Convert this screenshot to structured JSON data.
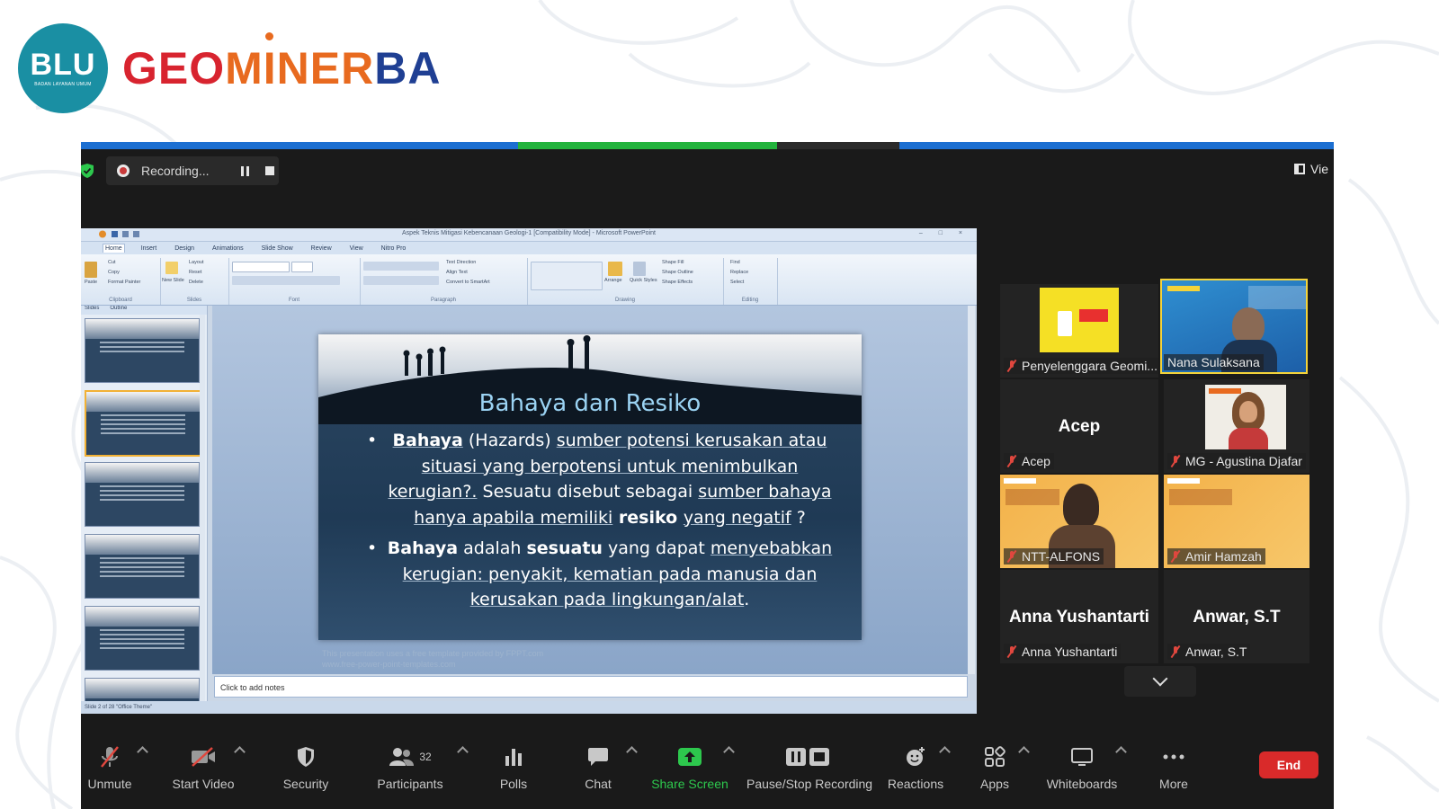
{
  "brand": {
    "badge_text": "BLU",
    "badge_subtext": "BADAN LAYANAN UMUM",
    "wordmark_part1": "GEO",
    "wordmark_part2": "MINER",
    "wordmark_part3": "BA",
    "colors": {
      "teal": "#1a8fa3",
      "red": "#d8242f",
      "orange": "#e86a1f",
      "blue": "#1f3f93"
    }
  },
  "zoom": {
    "recording_label": "Recording...",
    "view_label": "Vie",
    "accent_colors": {
      "top_bar": "#1c6fd1",
      "share_green": "#23b33d",
      "end_red": "#d92a2a",
      "muted_red": "#e0473e"
    }
  },
  "ppt": {
    "window_title": "Aspek Teknis Mitigasi Kebencanaan Geologi-1 [Compatibility Mode] - Microsoft PowerPoint",
    "tabs": [
      "Home",
      "Insert",
      "Design",
      "Animations",
      "Slide Show",
      "Review",
      "View",
      "Nitro Pro"
    ],
    "ribbon_groups": [
      "Clipboard",
      "Slides",
      "Font",
      "Paragraph",
      "Drawing",
      "Editing"
    ],
    "ribbon_items": {
      "cut": "Cut",
      "copy": "Copy",
      "format_painter": "Format Painter",
      "paste": "Paste",
      "layout": "Layout",
      "reset": "Reset",
      "delete": "Delete",
      "new_slide": "New Slide",
      "text_direction": "Text Direction",
      "align_text": "Align Text",
      "smartart": "Convert to SmartArt",
      "arrange": "Arrange",
      "quick_styles": "Quick Styles",
      "shape_fill": "Shape Fill",
      "shape_outline": "Shape Outline",
      "shape_effects": "Shape Effects",
      "find": "Find",
      "replace": "Replace",
      "select": "Select"
    },
    "panel_tabs": [
      "Slides",
      "Outline"
    ],
    "slide": {
      "title": "Bahaya dan Resiko",
      "bullet1_parts": [
        {
          "t": "Bahaya",
          "b": true,
          "u": true
        },
        {
          "t": " (Hazards) ",
          "b": false,
          "u": false
        },
        {
          "t": "sumber potensi kerusakan atau situasi yang berpotensi untuk menimbulkan kerugian?.",
          "b": false,
          "u": true
        },
        {
          "t": " Sesuatu disebut sebagai ",
          "b": false,
          "u": false
        },
        {
          "t": "sumber bahaya hanya apabila memiliki",
          "b": false,
          "u": true
        },
        {
          "t": " resiko ",
          "b": true,
          "u": false
        },
        {
          "t": "yang negatif",
          "b": false,
          "u": true
        },
        {
          "t": " ?",
          "b": false,
          "u": false
        }
      ],
      "bullet2_parts": [
        {
          "t": "Bahaya",
          "b": true,
          "u": false
        },
        {
          "t": " adalah ",
          "b": false,
          "u": false
        },
        {
          "t": "sesuatu",
          "b": true,
          "u": false
        },
        {
          "t": " yang dapat ",
          "b": false,
          "u": false
        },
        {
          "t": "menyebabkan kerugian: penyakit, kematian pada manusia dan kerusakan pada lingkungan/alat",
          "b": false,
          "u": true
        },
        {
          "t": ".",
          "b": false,
          "u": false
        }
      ]
    },
    "credit_line1": "This presentation uses a free template provided by FPPT.com",
    "credit_line2": "www.free-power-point-templates.com",
    "notes_placeholder": "Click to add notes",
    "status_text": "Slide 2 of 28   \"Office Theme\""
  },
  "participants": [
    {
      "name": "Penyelenggara Geomi...",
      "big": "",
      "video": "yellow-banner"
    },
    {
      "name": "Nana Sulaksana",
      "big": "",
      "video": "speaker",
      "active": true
    },
    {
      "name": "Acep",
      "big": "Acep",
      "video": "none"
    },
    {
      "name": "MG - Agustina Djafar",
      "big": "",
      "video": "person-hijab"
    },
    {
      "name": "NTT-ALFONS",
      "big": "",
      "video": "person-orange"
    },
    {
      "name": "Amir Hamzah",
      "big": "",
      "video": "orange"
    },
    {
      "name": "Anna Yushantarti",
      "big": "Anna Yushantarti",
      "video": "none"
    },
    {
      "name": "Anwar, S.T",
      "big": "Anwar, S.T",
      "video": "none"
    }
  ],
  "toolbar": {
    "unmute": "Unmute",
    "start_video": "Start Video",
    "security": "Security",
    "participants": "Participants",
    "participants_count": "32",
    "polls": "Polls",
    "chat": "Chat",
    "share_screen": "Share Screen",
    "pause_stop_recording": "Pause/Stop Recording",
    "reactions": "Reactions",
    "apps": "Apps",
    "whiteboards": "Whiteboards",
    "more": "More",
    "end": "End"
  }
}
